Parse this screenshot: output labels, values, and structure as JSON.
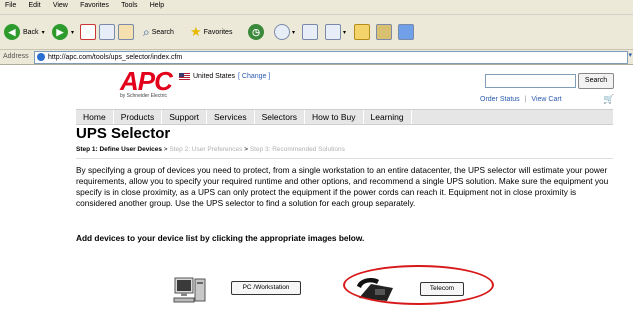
{
  "menu": [
    "File",
    "Edit",
    "View",
    "Favorites",
    "Tools",
    "Help"
  ],
  "toolbar": {
    "back_label": "Back",
    "search_label": "Search",
    "favorites_label": "Favorites"
  },
  "address": {
    "label": "Address",
    "url": "http://apc.com/tools/ups_selector/index.cfm"
  },
  "header": {
    "logo_text": "APC",
    "logo_sub": "by Schneider Electric",
    "country": "United States",
    "change_link": "[ Change ]",
    "search_button": "Search",
    "order_status": "Order Status",
    "separator": "|",
    "view_cart": "View Cart"
  },
  "nav": [
    "Home",
    "Products",
    "Support",
    "Services",
    "Selectors",
    "How to Buy",
    "Learning"
  ],
  "main": {
    "title": "UPS Selector",
    "step1": "Step 1: Define User Devices",
    "arrow": ">",
    "step2": "Step 2: User Preferences",
    "step3": "Step 3: Recommended Solutions",
    "description": "By specifying a group of devices you need to protect, from a single workstation to an entire datacenter, the UPS selector will estimate your power requirements, allow you to specify your required runtime and other options, and recommend a single UPS solution. Make sure the equipment you specify is in close proximity, as a UPS can only protect the equipment if the power cords can reach it. Equipment not in close proximity is considered another group. Use the UPS selector to find a solution for each group separately.",
    "prompt": "Add devices to your device list by clicking the appropriate images below.",
    "devices": {
      "pc_label": "PC /Workstation",
      "telecom_label": "Telecom"
    }
  },
  "colors": {
    "brand_red": "#e2001a",
    "link_blue": "#2a5bb0",
    "highlight_red": "#d81818"
  }
}
